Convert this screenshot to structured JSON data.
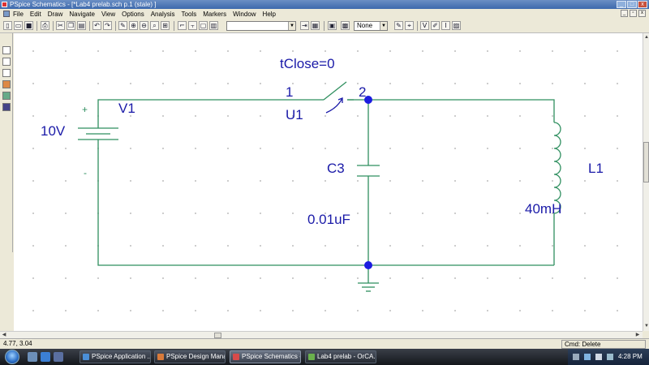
{
  "window": {
    "title": "PSpice Schematics - [*Lab4 prelab.sch  p.1  (stale)  ]"
  },
  "menu": [
    "File",
    "Edit",
    "Draw",
    "Navigate",
    "View",
    "Options",
    "Analysis",
    "Tools",
    "Markers",
    "Window",
    "Help"
  ],
  "toolbar": {
    "part_combo_value": "",
    "color_combo_value": "None"
  },
  "schematic": {
    "switch_param": "tClose=0",
    "pin1_label": "1",
    "pin2_label": "2",
    "switch_ref": "U1",
    "source_ref": "V1",
    "source_value": "10V",
    "plus_sign": "+",
    "minus_sign": "-",
    "cap_ref": "C3",
    "cap_value": "0.01uF",
    "ind_ref": "L1",
    "ind_value": "40mH",
    "wire_color": "#2f8f5f",
    "label_color": "#1a1aa8",
    "junction_color": "#1c1ce0"
  },
  "status": {
    "coords": "4.77, 3.04",
    "cmd": "Cmd: Delete"
  },
  "taskbar": {
    "tasks": [
      {
        "label": "PSpice Application ...",
        "color": "#4a8fd8"
      },
      {
        "label": "PSpice Design Mana...",
        "color": "#d87a3a"
      },
      {
        "label": "PSpice Schematics -...",
        "color": "#d84a4a"
      },
      {
        "label": "Lab4 prelab - OrCA...",
        "color": "#6ab04c"
      }
    ],
    "clock": "4:28 PM"
  }
}
